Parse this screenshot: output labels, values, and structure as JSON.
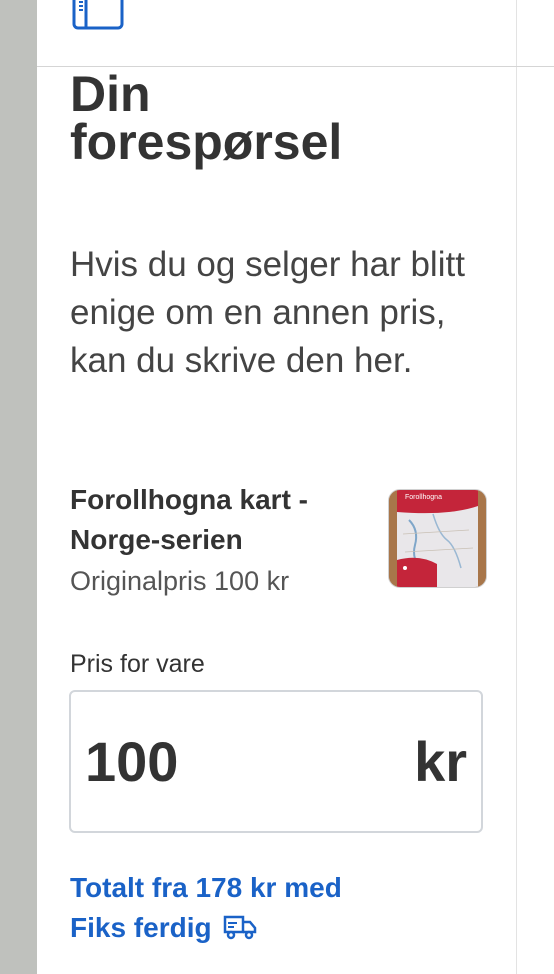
{
  "page": {
    "title_line1": "Din",
    "title_line2": "forespørsel",
    "description": "Hvis du og selger har blitt enige om en annen pris, kan du skrive den her."
  },
  "product": {
    "name": "Forollhogna kart - Norge-serien",
    "original_price": "Originalpris 100 kr",
    "thumbnail_label": "Forollhogna"
  },
  "price_field": {
    "label": "Pris for vare",
    "value": "100",
    "unit": "kr"
  },
  "total": {
    "line1": "Totalt fra 178 kr med",
    "line2": "Fiks ferdig"
  },
  "colors": {
    "link": "#1a62c7",
    "text": "#333333",
    "side_strip": "#bfc1bd"
  },
  "icons": {
    "top": "document-icon",
    "total": "truck-icon"
  }
}
